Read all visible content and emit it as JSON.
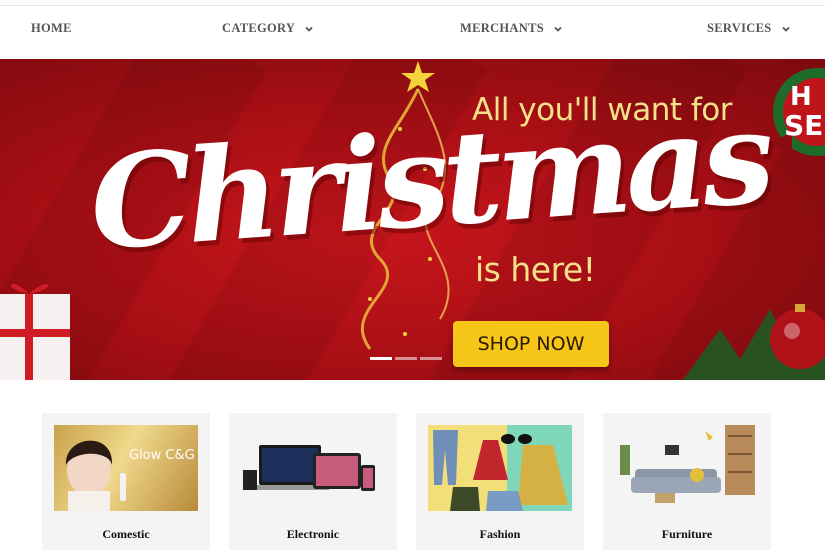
{
  "nav": {
    "home": "HOME",
    "category": "CATEGORY",
    "merchants": "MERCHANTS",
    "services": "SERVICES"
  },
  "banner": {
    "script_word": "Christmas",
    "tagline_top": "All you'll want for",
    "tagline_bottom": "is here!",
    "cta": "SHOP NOW",
    "slide_count": 3,
    "active_slide": 1,
    "badge_text": "H SE D"
  },
  "categories": [
    {
      "label": "Comestic",
      "thumb_text": "Glow C&G"
    },
    {
      "label": "Electronic"
    },
    {
      "label": "Fashion"
    },
    {
      "label": "Furniture"
    }
  ],
  "colors": {
    "banner_red": "#b3121a",
    "cta_yellow": "#f5c518",
    "tagline_gold": "#f3e28a",
    "nav_text": "#555555"
  }
}
